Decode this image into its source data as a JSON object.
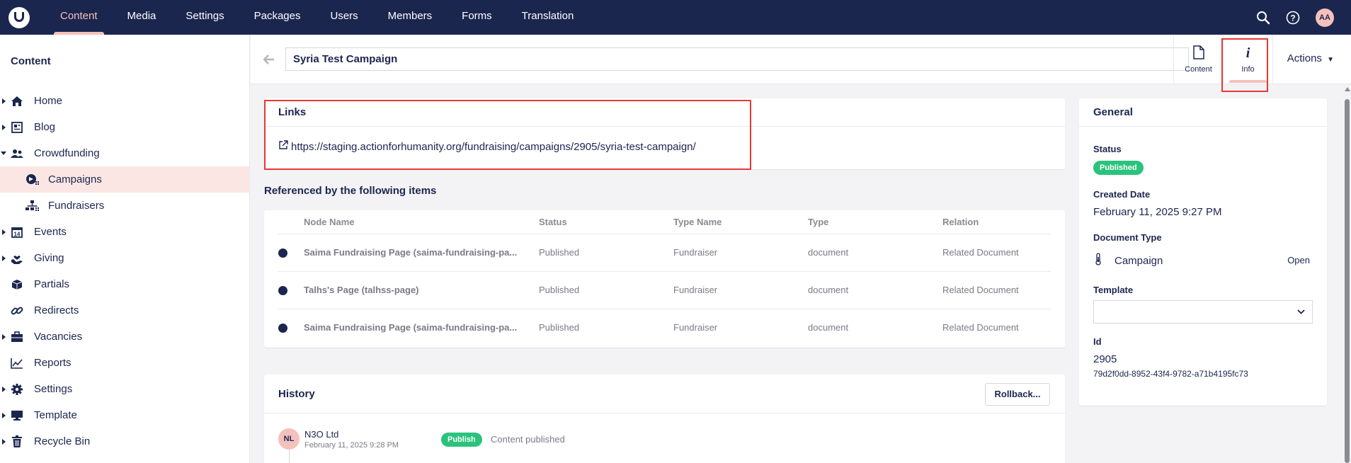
{
  "topnav": {
    "items": [
      "Content",
      "Media",
      "Settings",
      "Packages",
      "Users",
      "Members",
      "Forms",
      "Translation"
    ],
    "active": "Content",
    "user_initials": "AA",
    "icons": [
      "search-icon",
      "help-icon"
    ]
  },
  "sidebar": {
    "title": "Content",
    "items": [
      {
        "label": "Home",
        "icon": "house-icon",
        "expandable": true
      },
      {
        "label": "Blog",
        "icon": "newspaper-icon",
        "expandable": true
      },
      {
        "label": "Crowdfunding",
        "icon": "people-icon",
        "expandable": true,
        "expanded": true
      },
      {
        "label": "Campaigns",
        "icon": "campaign-icon",
        "child": true,
        "active": true
      },
      {
        "label": "Fundraisers",
        "icon": "sitemap-icon",
        "child": true
      },
      {
        "label": "Events",
        "icon": "calendar-icon",
        "expandable": true
      },
      {
        "label": "Giving",
        "icon": "hand-heart-icon",
        "expandable": true
      },
      {
        "label": "Partials",
        "icon": "box-icon",
        "expandable": false
      },
      {
        "label": "Redirects",
        "icon": "link-icon",
        "expandable": false
      },
      {
        "label": "Vacancies",
        "icon": "briefcase-icon",
        "expandable": true
      },
      {
        "label": "Reports",
        "icon": "chart-icon",
        "expandable": false
      },
      {
        "label": "Settings",
        "icon": "gear-icon",
        "expandable": true
      },
      {
        "label": "Template",
        "icon": "monitor-icon",
        "expandable": true
      },
      {
        "label": "Recycle Bin",
        "icon": "trash-icon",
        "expandable": true
      }
    ]
  },
  "editor": {
    "name_value": "Syria Test Campaign",
    "tabs": {
      "content": "Content",
      "info": "Info"
    },
    "actions_label": "Actions"
  },
  "links": {
    "title": "Links",
    "url": "https://staging.actionforhumanity.org/fundraising/campaigns/2905/syria-test-campaign/"
  },
  "references": {
    "title": "Referenced by the following items",
    "columns": [
      "Node Name",
      "Status",
      "Type Name",
      "Type",
      "Relation"
    ],
    "rows": [
      [
        "Saima Fundraising Page (saima-fundraising-pa...",
        "Published",
        "Fundraiser",
        "document",
        "Related Document"
      ],
      [
        "Talhs's Page (talhss-page)",
        "Published",
        "Fundraiser",
        "document",
        "Related Document"
      ],
      [
        "Saima Fundraising Page (saima-fundraising-pa...",
        "Published",
        "Fundraiser",
        "document",
        "Related Document"
      ]
    ]
  },
  "history": {
    "title": "History",
    "rollback_label": "Rollback...",
    "entries": [
      {
        "initials": "NL",
        "user": "N3O Ltd",
        "date": "February 11, 2025 9:28 PM",
        "badge": "Publish",
        "text": "Content published"
      }
    ]
  },
  "general": {
    "title": "General",
    "status_label": "Status",
    "status_value": "Published",
    "created_label": "Created Date",
    "created_value": "February 11, 2025 9:27 PM",
    "doctype_label": "Document Type",
    "doctype_value": "Campaign",
    "doctype_open": "Open",
    "template_label": "Template",
    "template_value": "",
    "id_label": "Id",
    "id_value": "2905",
    "guid_value": "79d2f0dd-8952-43f4-9782-a71b4195fc73"
  },
  "colors": {
    "nav_bg": "#1b264f",
    "accent": "#f5c1bc",
    "published_green": "#2bc37c",
    "highlight_red": "#e53935"
  }
}
